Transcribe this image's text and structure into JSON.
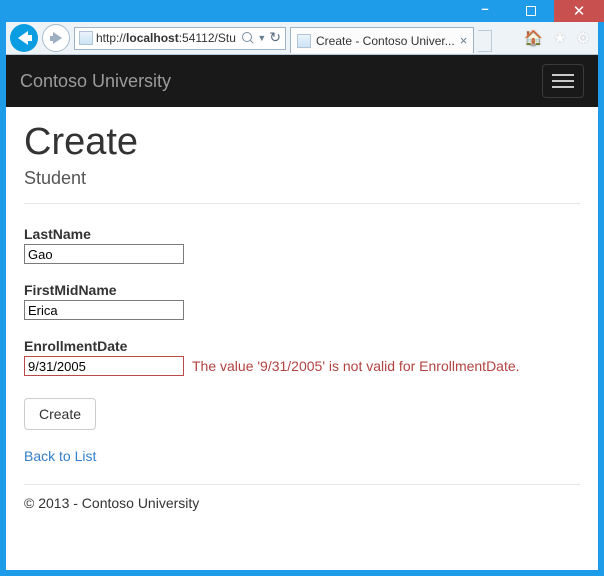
{
  "window": {
    "url_host": "localhost",
    "url_rest": ":54112/Stu",
    "tab_title": "Create - Contoso Univer..."
  },
  "navbar": {
    "brand": "Contoso University"
  },
  "page": {
    "heading": "Create",
    "subheading": "Student",
    "fields": {
      "lastName": {
        "label": "LastName",
        "value": "Gao"
      },
      "firstMid": {
        "label": "FirstMidName",
        "value": "Erica"
      },
      "enrollDate": {
        "label": "EnrollmentDate",
        "value": "9/31/2005",
        "error": "The value '9/31/2005' is not valid for EnrollmentDate."
      }
    },
    "submit_label": "Create",
    "back_link": "Back to List"
  },
  "footer": {
    "text": "© 2013 - Contoso University"
  }
}
